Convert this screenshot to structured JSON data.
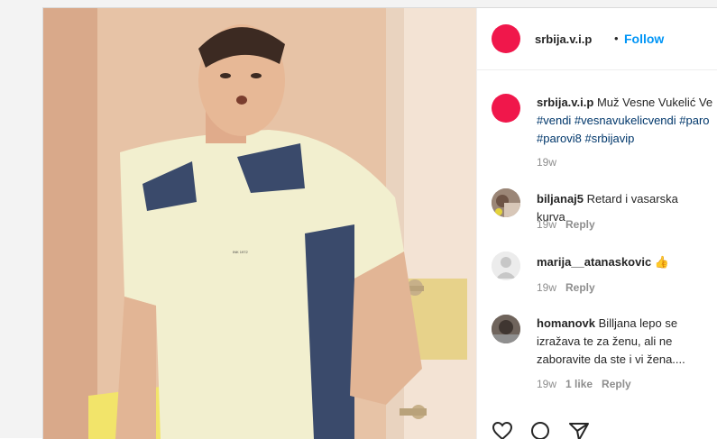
{
  "post": {
    "username": "srbija.v.i.p",
    "separator": "•",
    "follow_label": "Follow"
  },
  "caption": {
    "username": "srbija.v.i.p",
    "text": "Muž Vesne Vukelić Ve",
    "hashtags_line1": "#vendi #vesnavukelicvendi #paro",
    "hashtags_line2": "#parovi8 #srbijavip",
    "time": "19w"
  },
  "comments": [
    {
      "username": "biljanaj5",
      "text": "Retard i vasarska kurva",
      "time": "19w",
      "reply": "Reply"
    },
    {
      "username": "marija__atanaskovic",
      "text": "👍",
      "time": "19w",
      "reply": "Reply"
    },
    {
      "username": "homanovk",
      "text_line1": "Billjana lepo se",
      "text_line2": "izražava te za ženu, ali ne",
      "text_line3": "zaboravite da ste i vi žena....",
      "time": "19w",
      "likes": "1 like",
      "reply": "Reply"
    }
  ],
  "actions": [
    "heart-icon",
    "comment-icon",
    "share-icon"
  ]
}
